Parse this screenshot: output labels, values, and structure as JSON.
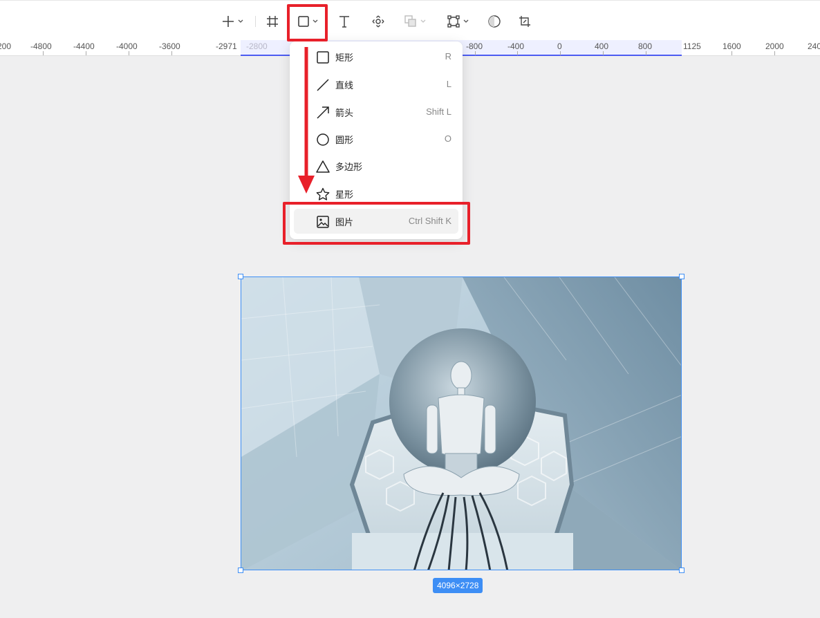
{
  "toolbar": {
    "items": [
      {
        "icon": "plus-icon",
        "has_menu": true
      },
      {
        "icon": "frame-icon",
        "has_menu": false
      },
      {
        "icon": "rectangle-icon",
        "has_menu": true
      },
      {
        "icon": "text-icon",
        "has_menu": false
      },
      {
        "icon": "move-icon",
        "has_menu": false
      },
      {
        "icon": "boolean-icon",
        "has_menu": true
      },
      {
        "icon": "vector-path-icon",
        "has_menu": true
      },
      {
        "icon": "ellipse-icon",
        "has_menu": false
      },
      {
        "icon": "crop-icon",
        "has_menu": false
      }
    ]
  },
  "ruler": {
    "labels": [
      "200",
      "-4800",
      "-4400",
      "-4000",
      "-3600",
      "-2971",
      "-2800",
      "-800",
      "-400",
      "0",
      "400",
      "800",
      "1125",
      "1600",
      "2000",
      "240"
    ]
  },
  "shape_menu": {
    "items": [
      {
        "icon": "rectangle-icon",
        "label": "矩形",
        "shortcut": "R"
      },
      {
        "icon": "line-icon",
        "label": "直线",
        "shortcut": "L"
      },
      {
        "icon": "arrow-icon",
        "label": "箭头",
        "shortcut": "Shift L"
      },
      {
        "icon": "circle-icon",
        "label": "圆形",
        "shortcut": "O"
      },
      {
        "icon": "polygon-icon",
        "label": "多边形",
        "shortcut": ""
      },
      {
        "icon": "star-icon",
        "label": "星形",
        "shortcut": ""
      },
      {
        "icon": "image-icon",
        "label": "图片",
        "shortcut": "Ctrl Shift K"
      }
    ],
    "highlighted_index": 6
  },
  "canvas": {
    "image_size_badge": "4096×2728"
  },
  "colors": {
    "accent": "#3d8ef5",
    "annotation_red": "#e8202a",
    "ruler_selection": "#4b5bf2"
  }
}
